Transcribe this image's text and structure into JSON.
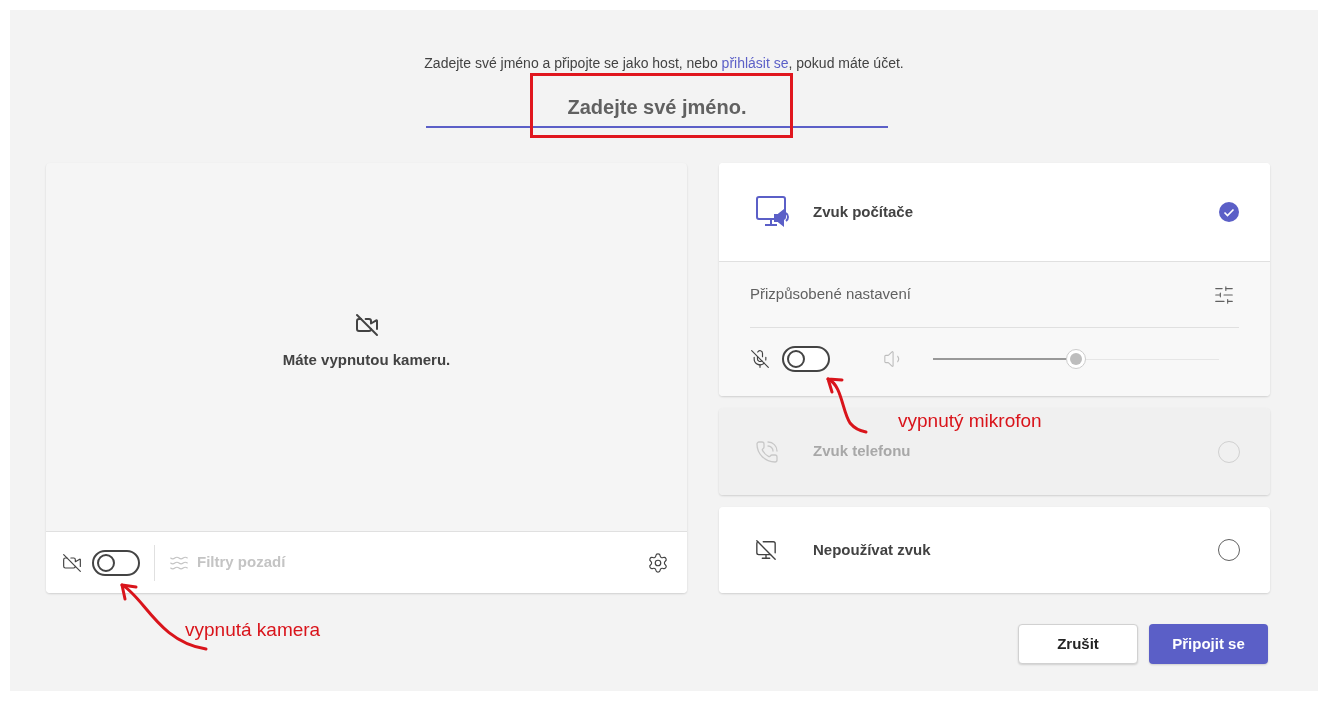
{
  "intro": {
    "before": "Zadejte své jméno a připojte se jako host, nebo ",
    "link": "přihlásit se",
    "after": ", pokud máte účet."
  },
  "name_field": {
    "placeholder": "Zadejte své jméno.",
    "highlighted": true
  },
  "camera": {
    "message": "Máte vypnutou kameru.",
    "on": false,
    "filters_label": "Filtry pozadí",
    "filters_disabled": true
  },
  "audio_options": [
    {
      "kind": "computer",
      "label": "Zvuk počítače",
      "selected": true,
      "disabled": false
    },
    {
      "kind": "phone",
      "label": "Zvuk telefonu",
      "selected": false,
      "disabled": true
    },
    {
      "kind": "none",
      "label": "Nepoužívat zvuk",
      "selected": false,
      "disabled": false
    }
  ],
  "audio_settings": {
    "label": "Přizpůsobené nastavení",
    "mic_on": false,
    "volume": {
      "level": 0.5
    }
  },
  "buttons": [
    {
      "kind": "secondary",
      "label": "Zrušit"
    },
    {
      "kind": "primary",
      "label": "Připojit se"
    }
  ],
  "annotations": {
    "camera_note": "vypnutá kamera",
    "mic_note": "vypnutý mikrofon"
  }
}
